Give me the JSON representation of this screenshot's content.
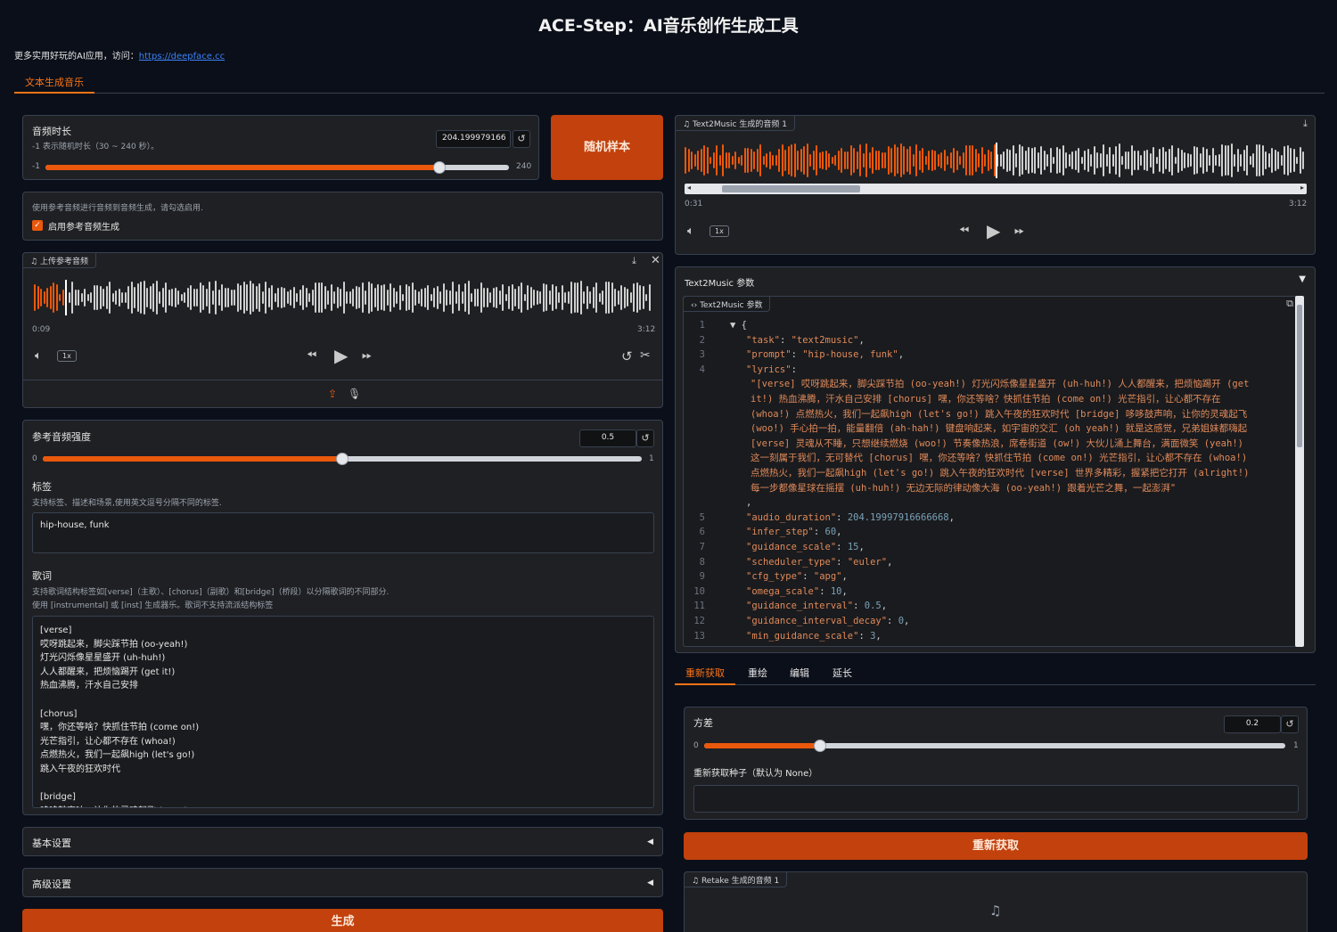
{
  "app": {
    "title": "ACE-Step：AI音乐创作生成工具",
    "intro_text": "更多实用好玩的AI应用，访问：",
    "intro_link": "https://deepface.cc"
  },
  "main_tabs": [
    {
      "label": "文本生成音乐",
      "active": true
    }
  ],
  "duration": {
    "label": "音频时长",
    "info": "-1 表示随机时长（30 ~ 240 秒）。",
    "value": "204.199979166",
    "min_label": "-1",
    "max_label": "240",
    "fraction": 0.85
  },
  "random_button": "随机样本",
  "ref_audio_toggle": {
    "info": "使用参考音频进行音频到音频生成，请勾选启用.",
    "label": "启用参考音频生成",
    "checked": true
  },
  "upload_audio": {
    "label": "上传参考音频",
    "current_time": "0:09",
    "total_time": "3:12",
    "speed": "1x",
    "progress": 0.05
  },
  "ref_strength": {
    "label": "参考音频强度",
    "value": "0.5",
    "min_label": "0",
    "max_label": "1",
    "fraction": 0.5
  },
  "tags": {
    "label": "标签",
    "info": "支持标签、描述和场景,使用英文逗号分隔不同的标签.",
    "value": "hip-house, funk"
  },
  "lyrics": {
    "label": "歌词",
    "info1": "支持歌词结构标签如[verse]（主歌）、[chorus]（副歌）和[bridge]（桥段）以分隔歌词的不同部分.",
    "info2": "使用 [instrumental] 或 [inst] 生成器乐。歌词不支持流派结构标签",
    "lines": [
      "[verse]",
      "哎呀跳起来，脚尖踩节拍 (oo-yeah!)",
      "灯光闪烁像星星盛开 (uh-huh!)",
      "人人都醒来，把烦恼踢开 (get it!)",
      "热血沸腾，汗水自己安排",
      "",
      "[chorus]",
      "嘿，你还等啥？快抓住节拍 (come on!)",
      "光芒指引，让心都不存在 (whoa!)",
      "点燃热火，我们一起飙high (let's go!)",
      "跳入午夜的狂欢时代",
      "",
      "[bridge]",
      "哆哆鼓声响，让你的灵魂起飞 (woo!)"
    ]
  },
  "accordions": [
    {
      "label": "基本设置"
    },
    {
      "label": "高级设置"
    }
  ],
  "generate_button": "生成",
  "output_audio": {
    "label": "Text2Music 生成的音频 1",
    "current_time": "0:31",
    "total_time": "3:12",
    "speed": "1x",
    "progress": 0.5
  },
  "params": {
    "section_label": "Text2Music 参数",
    "chip_label": "Text2Music 参数",
    "lyrics_wrapped": [
      "\"[verse] 哎呀跳起来，脚尖踩节拍 (oo-yeah!) 灯光闪烁像星星盛开 (uh-huh!) 人人都醒来，把烦恼踢开 (get",
      "it!) 热血沸腾，汗水自己安排 [chorus] 嘿，你还等啥？快抓住节拍 (come on!) 光芒指引，让心都不存在",
      "(whoa!) 点燃热火，我们一起飙high (let's go!) 跳入午夜的狂欢时代 [bridge] 哆哆鼓声响，让你的灵魂起飞",
      "(woo!) 手心拍一拍，能量翻倍 (ah-hah!) 键盘响起来，如宇宙的交汇 (oh yeah!) 就是这感觉，兄弟姐妹都嗨起",
      "[verse] 灵魂从不睡，只想继续燃烧 (woo!) 节奏像热浪，席卷街道 (ow!) 大伙儿涌上舞台，满面微笑 (yeah!)",
      "这一刻属于我们，无可替代 [chorus] 嘿，你还等啥？快抓住节拍 (come on!) 光芒指引，让心都不存在 (whoa!)",
      "点燃热火，我们一起飙high (let's go!) 跳入午夜的狂欢时代 [verse] 世界多精彩，握紧把它打开 (alright!)",
      "每一步都像星球在摇摆 (uh-huh!) 无边无际的律动像大海 (oo-yeah!) 跟着光芒之舞，一起澎湃\""
    ],
    "entries": [
      {
        "key": "\"task\"",
        "val": "\"text2music\"",
        "type": "s"
      },
      {
        "key": "\"prompt\"",
        "val": "\"hip-house, funk\"",
        "type": "s"
      },
      {
        "key": "\"audio_duration\"",
        "val": "204.19997916666668",
        "type": "n"
      },
      {
        "key": "\"infer_step\"",
        "val": "60",
        "type": "n"
      },
      {
        "key": "\"guidance_scale\"",
        "val": "15",
        "type": "n"
      },
      {
        "key": "\"scheduler_type\"",
        "val": "\"euler\"",
        "type": "s"
      },
      {
        "key": "\"cfg_type\"",
        "val": "\"apg\"",
        "type": "s"
      },
      {
        "key": "\"omega_scale\"",
        "val": "10",
        "type": "n"
      },
      {
        "key": "\"guidance_interval\"",
        "val": "0.5",
        "type": "n"
      },
      {
        "key": "\"guidance_interval_decay\"",
        "val": "0",
        "type": "n"
      },
      {
        "key": "\"min_guidance_scale\"",
        "val": "3",
        "type": "n"
      }
    ],
    "lyrics_key": "\"lyrics\""
  },
  "edit_tabs": [
    {
      "label": "重新获取",
      "active": true
    },
    {
      "label": "重绘",
      "active": false
    },
    {
      "label": "编辑",
      "active": false
    },
    {
      "label": "延长",
      "active": false
    }
  ],
  "variance": {
    "label": "方差",
    "value": "0.2",
    "min_label": "0",
    "max_label": "1",
    "fraction": 0.2
  },
  "retake_seed": {
    "label": "重新获取种子（默认为 None）",
    "value": ""
  },
  "retake_button": "重新获取",
  "retake_audio": {
    "label": "Retake 生成的音频 1"
  },
  "colors": {
    "accent": "#ea580c",
    "button": "#c2410c",
    "background": "#0b0f19",
    "panel": "#1f2023"
  }
}
